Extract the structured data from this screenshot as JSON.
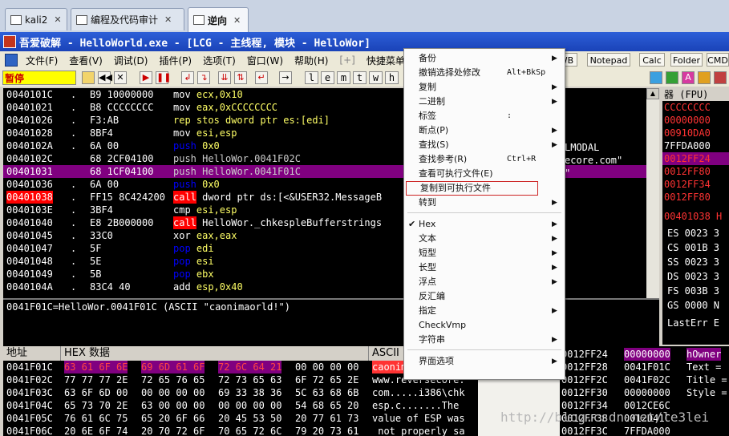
{
  "vm_tabs": [
    {
      "label": "kali2",
      "close": "✕"
    },
    {
      "label": "编程及代码审计",
      "close": "✕"
    },
    {
      "label": "逆向",
      "close": "✕"
    }
  ],
  "window_title": "吾爱破解 - HelloWorld.exe - [LCG -  主线程, 模块 - HelloWor]",
  "menu": [
    "文件(F)",
    "查看(V)",
    "调试(D)",
    "插件(P)",
    "选项(T)",
    "窗口(W)",
    "帮助(H)",
    "[+]",
    "快捷菜单",
    "T"
  ],
  "plugin_buttons": [
    "WB",
    "Notepad",
    "Calc",
    "Folder",
    "CMD"
  ],
  "toolbar": {
    "status": "暂停",
    "letters": [
      "l",
      "e",
      "m",
      "t",
      "w",
      "h"
    ],
    "icons": [
      "open-icon",
      "rewind-icon",
      "close-icon",
      "run-icon",
      "pause-icon",
      "step-into-icon",
      "step-over-icon",
      "trace-into-icon",
      "trace-over-icon",
      "execute-till-return-icon",
      "goto-icon"
    ]
  },
  "disasm": [
    {
      "addr": "0040101C",
      "mark": ".",
      "hex": "B9 10000000",
      "op": "mov",
      "args": "ecx,0x10",
      "kind": "mov"
    },
    {
      "addr": "00401021",
      "mark": ".",
      "hex": "B8 CCCCCCCC",
      "op": "mov",
      "args": "eax,0xCCCCCCCC",
      "kind": "mov"
    },
    {
      "addr": "00401026",
      "mark": ".",
      "hex": "F3:AB",
      "op": "rep stos",
      "args": "dword ptr es:[edi]",
      "kind": "rep"
    },
    {
      "addr": "00401028",
      "mark": ".",
      "hex": "8BF4",
      "op": "mov",
      "args": "esi,esp",
      "kind": "mov"
    },
    {
      "addr": "0040102A",
      "mark": ".",
      "hex": "6A 00",
      "op": "push",
      "args": "0x0",
      "kind": "push"
    },
    {
      "addr": "0040102C",
      "mark": "",
      "hex": "68 2CF04100",
      "op": "push",
      "args": "HelloWor.0041F02C",
      "kind": "push2"
    },
    {
      "addr": "00401031",
      "mark": "",
      "hex": "68 1CF04100",
      "op": "push",
      "args": "HelloWor.0041F01C",
      "kind": "push2",
      "selected": true
    },
    {
      "addr": "00401036",
      "mark": ".",
      "hex": "6A 00",
      "op": "push",
      "args": "0x0",
      "kind": "push"
    },
    {
      "addr": "00401038",
      "mark": ".",
      "hex": "FF15 8C424200",
      "op": "call",
      "args": "dword ptr ds:[<&USER32.MessageB",
      "kind": "call",
      "bp": true
    },
    {
      "addr": "0040103E",
      "mark": ".",
      "hex": "3BF4",
      "op": "cmp",
      "args": "esi,esp",
      "kind": "mov"
    },
    {
      "addr": "00401040",
      "mark": ".",
      "hex": "E8 2B000000",
      "op": "call",
      "args": "HelloWor._chkespleBufferstrings",
      "kind": "call"
    },
    {
      "addr": "00401045",
      "mark": ".",
      "hex": "33C0",
      "op": "xor",
      "args": "eax,eax",
      "kind": "mov"
    },
    {
      "addr": "00401047",
      "mark": ".",
      "hex": "5F",
      "op": "pop",
      "args": "edi",
      "kind": "pop"
    },
    {
      "addr": "00401048",
      "mark": ".",
      "hex": "5E",
      "op": "pop",
      "args": "esi",
      "kind": "pop"
    },
    {
      "addr": "00401049",
      "mark": ".",
      "hex": "5B",
      "op": "pop",
      "args": "ebx",
      "kind": "pop"
    },
    {
      "addr": "0040104A",
      "mark": ".",
      "hex": "83C4 40",
      "op": "add",
      "args": "esp,0x40",
      "kind": "mov"
    }
  ],
  "right_comments": [
    "LMODAL",
    "ecore.com\"",
    "\""
  ],
  "info_line": "0041F01C=HelloWor.0041F01C (ASCII \"caonimaorld!\")",
  "registers": {
    "header": "器 (FPU)",
    "stack_vals": [
      "CCCCCCCC",
      "00000000",
      "00910DA0",
      "7FFDA000",
      "0012FF24",
      "0012FF80",
      "0012FF34",
      "0012FF80"
    ],
    "eip": "00401038 H",
    "segs": [
      "ES 0023 3",
      "CS 001B 3",
      "SS 0023 3",
      "DS 0023 3",
      "FS 003B 3",
      "GS 0000 N"
    ],
    "lasterr": "LastErr E"
  },
  "dump": {
    "col_addr": "地址",
    "col_hex": "HEX 数据",
    "col_ascii": "ASCII",
    "rows": [
      {
        "addr": "0041F01C",
        "hex1": "63 61 6F 6E",
        "hex2": "69 6D 61 6F",
        "hex3": "72 6C 64 21",
        "hex4": "00 00 00 00",
        "ascii": "caonimaorld!",
        "hl": true
      },
      {
        "addr": "0041F02C",
        "hex1": "77 77 77 2E",
        "hex2": "72 65 76 65",
        "hex3": "72 73 65 63",
        "hex4": "6F 72 65 2E",
        "ascii": "www.reversecore."
      },
      {
        "addr": "0041F03C",
        "hex1": "63 6F 6D 00",
        "hex2": "00 00 00 00",
        "hex3": "69 33 38 36",
        "hex4": "5C 63 68 6B",
        "ascii": "com.....i386\\chk"
      },
      {
        "addr": "0041F04C",
        "hex1": "65 73 70 2E",
        "hex2": "63 00 00 00",
        "hex3": "00 00 00 00",
        "hex4": "54 68 65 20",
        "ascii": "esp.c.......The "
      },
      {
        "addr": "0041F05C",
        "hex1": "76 61 6C 75",
        "hex2": "65 20 6F 66",
        "hex3": "20 45 53 50",
        "hex4": "20 77 61 73",
        "ascii": "value of ESP was"
      },
      {
        "addr": "0041F06C",
        "hex1": "20 6E 6F 74",
        "hex2": "20 70 72 6F",
        "hex3": "70 65 72 6C",
        "hex4": "79 20 73 61",
        "ascii": " not properly sa"
      }
    ]
  },
  "stack": {
    "rows": [
      {
        "addr": "0012FF24",
        "val": "00000000",
        "cmt": "hOwner"
      },
      {
        "addr": "0012FF28",
        "val": "0041F01C",
        "cmt": "Text ="
      },
      {
        "addr": "0012FF2C",
        "val": "0041F02C",
        "cmt": "Title ="
      },
      {
        "addr": "0012FF30",
        "val": "00000000",
        "cmt": "Style ="
      },
      {
        "addr": "0012FF34",
        "val": "0012CE6C",
        "cmt": ""
      },
      {
        "addr": "0012FF38",
        "val": "0012D41C",
        "cmt": ""
      },
      {
        "addr": "0012FF3C",
        "val": "7FFDA000",
        "cmt": ""
      }
    ]
  },
  "context_menu": [
    {
      "label": "备份",
      "arrow": true
    },
    {
      "label": "撤销选择处修改",
      "shortcut": "Alt+BkSp"
    },
    {
      "label": "复制",
      "arrow": true
    },
    {
      "label": "二进制",
      "arrow": true
    },
    {
      "label": "标签",
      "shortcut": ":"
    },
    {
      "label": "断点(P)",
      "arrow": true
    },
    {
      "label": "查找(S)",
      "arrow": true
    },
    {
      "label": "查找参考(R)",
      "shortcut": "Ctrl+R"
    },
    {
      "label": "查看可执行文件(E)"
    },
    {
      "label": "复制到可执行文件",
      "boxed": true
    },
    {
      "label": "转到",
      "arrow": true
    },
    {
      "sep": true
    },
    {
      "label": "Hex",
      "arrow": true,
      "checked": true
    },
    {
      "label": "文本",
      "arrow": true
    },
    {
      "label": "短型",
      "arrow": true
    },
    {
      "label": "长型",
      "arrow": true
    },
    {
      "label": "浮点",
      "arrow": true
    },
    {
      "label": "反汇编"
    },
    {
      "label": "指定",
      "arrow": true
    },
    {
      "label": "CheckVmp"
    },
    {
      "label": "字符串",
      "arrow": true
    },
    {
      "sep": true
    },
    {
      "label": "界面选项",
      "arrow": true
    }
  ],
  "watermark": "http://blog.csdn.net/le3lei",
  "colors": {
    "selection": "#800080",
    "breakpoint": "#ff0000",
    "keyword_blue": "#0000ff",
    "arg_yellow": "#ffff66"
  }
}
